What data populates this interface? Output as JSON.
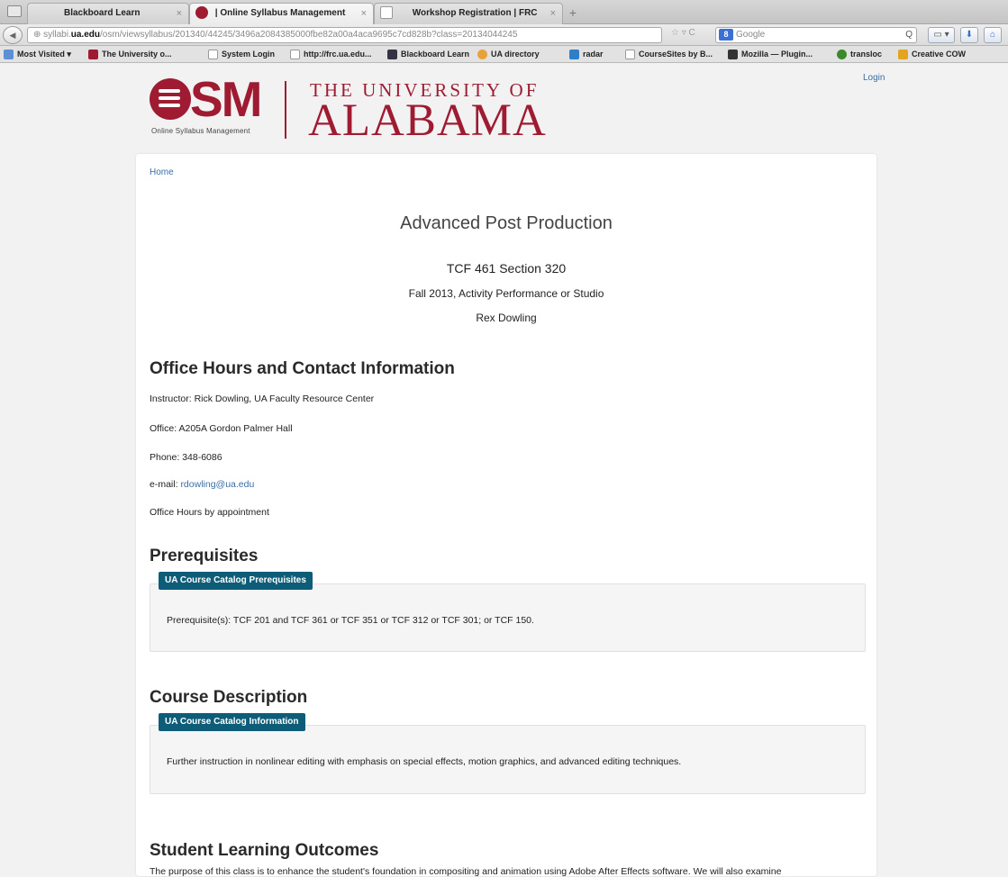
{
  "browser": {
    "tabs": [
      {
        "label": "Blackboard Learn",
        "close": "×"
      },
      {
        "label": "| Online Syllabus Management",
        "close": "×"
      },
      {
        "label": "Workshop Registration | FRC",
        "close": "×"
      }
    ],
    "new_tab": "+",
    "url_prefix": "syllabi.",
    "url_domain": "ua.edu",
    "url_rest": "/osm/viewsyllabus/201340/44245/3496a2084385000fbe82a00a4aca9695c7cd828b?class=20134044245",
    "url_icons": "☆ ▿ C",
    "search_engine_badge": "8",
    "search_placeholder": "Google",
    "search_glyph": "Q",
    "bookmarks": [
      "Most Visited ▾",
      "The University o...",
      "System Login",
      "http://frc.ua.edu...",
      "Blackboard Learn",
      "UA directory",
      "radar",
      "CourseSites by B...",
      "Mozilla — Plugin...",
      "transloc",
      "Creative COW"
    ]
  },
  "header": {
    "login": "Login",
    "logo_text": "SM",
    "logo_sub": "Online Syllabus Management",
    "univ_top": "THE UNIVERSITY OF",
    "univ_big": "ALABAMA"
  },
  "content": {
    "breadcrumb": "Home",
    "title": "Advanced Post Production",
    "course": "TCF 461 Section 320",
    "term": "Fall 2013, Activity Performance or Studio",
    "instructor_name": "Rex Dowling",
    "office_heading": "Office Hours and Contact Information",
    "instructor_line": "Instructor: Rick Dowling, UA Faculty Resource Center",
    "office_line": "Office: A205A Gordon Palmer Hall",
    "phone_line": "Phone: 348-6086",
    "email_label": "e-mail: ",
    "email": "rdowling@ua.edu",
    "hours_line": "Office Hours by appointment",
    "prereq_heading": "Prerequisites",
    "prereq_tab": "UA Course Catalog Prerequisites",
    "prereq_text": "Prerequisite(s): TCF 201 and TCF 361 or TCF 351 or TCF 312 or TCF 301; or TCF 150.",
    "desc_heading": "Course Description",
    "desc_tab": "UA Course Catalog Information",
    "desc_text": "Further instruction in nonlinear editing with emphasis on special effects, motion graphics, and advanced editing techniques.",
    "outcomes_heading": "Student Learning Outcomes",
    "outcomes_text": "The purpose of this class is to enhance the student's foundation in compositing and animation using Adobe After Effects software. We will also examine"
  },
  "colors": {
    "crimson": "#9e1b32",
    "tab_teal": "#0e5d78",
    "link": "#3a6ea5"
  }
}
